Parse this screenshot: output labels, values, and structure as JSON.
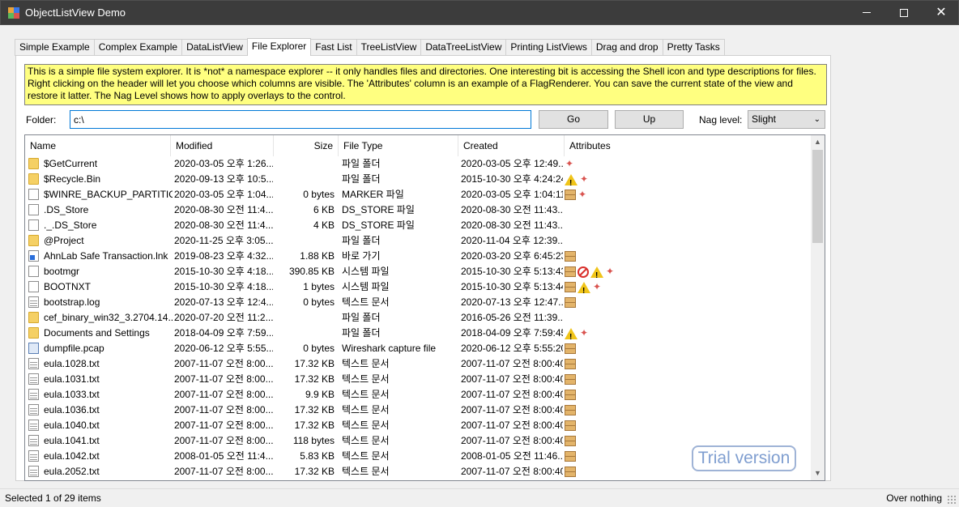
{
  "window": {
    "title": "ObjectListView Demo",
    "buttons": {
      "minimize": "—",
      "maximize": "□",
      "close": "✕"
    }
  },
  "tabs": [
    {
      "label": "Simple Example"
    },
    {
      "label": "Complex Example"
    },
    {
      "label": "DataListView"
    },
    {
      "label": "File Explorer",
      "active": true
    },
    {
      "label": "Fast List"
    },
    {
      "label": "TreeListView"
    },
    {
      "label": "DataTreeListView"
    },
    {
      "label": "Printing ListViews"
    },
    {
      "label": "Drag and drop"
    },
    {
      "label": "Pretty Tasks"
    }
  ],
  "info_text": "This is a simple file system explorer. It is *not* a namespace explorer -- it only handles files and directories. One interesting bit is accessing the Shell icon and type descriptions for files. Right clicking on the header will let you choose which columns are visible. The 'Attributes' column is an example of a FlagRenderer. You can save the current state of the view and restore it latter. The Nag Level shows how to apply overlays to the control.",
  "folder": {
    "label": "Folder:",
    "value": "c:\\"
  },
  "buttons": {
    "go": "Go",
    "up": "Up"
  },
  "nag": {
    "label": "Nag level:",
    "selected": "Slight"
  },
  "columns": [
    "Name",
    "Modified",
    "Size",
    "File Type",
    "Created",
    "Attributes"
  ],
  "rows": [
    {
      "icon": "folder",
      "name": "$GetCurrent",
      "modified": "2020-03-05 오후 1:26...",
      "size": "",
      "type": "파일 폴더",
      "created": "2020-03-05 오후 12:49...",
      "attrs": [
        "spark"
      ]
    },
    {
      "icon": "folder",
      "name": "$Recycle.Bin",
      "modified": "2020-09-13 오후 10:5...",
      "size": "",
      "type": "파일 폴더",
      "created": "2015-10-30 오후 4:24:24",
      "attrs": [
        "warn",
        "spark"
      ]
    },
    {
      "icon": "file",
      "name": "$WINRE_BACKUP_PARTITIO...",
      "modified": "2020-03-05 오후 1:04...",
      "size": "0 bytes",
      "type": "MARKER 파일",
      "created": "2020-03-05 오후 1:04:11",
      "attrs": [
        "pkg",
        "spark"
      ]
    },
    {
      "icon": "file",
      "name": ".DS_Store",
      "modified": "2020-08-30 오전 11:4...",
      "size": "6 KB",
      "type": "DS_STORE 파일",
      "created": "2020-08-30 오전 11:43...",
      "attrs": []
    },
    {
      "icon": "file",
      "name": "._.DS_Store",
      "modified": "2020-08-30 오전 11:4...",
      "size": "4 KB",
      "type": "DS_STORE 파일",
      "created": "2020-08-30 오전 11:43...",
      "attrs": []
    },
    {
      "icon": "folder",
      "name": "@Project",
      "modified": "2020-11-25 오후 3:05...",
      "size": "",
      "type": "파일 폴더",
      "created": "2020-11-04 오후 12:39...",
      "attrs": []
    },
    {
      "icon": "link",
      "name": "AhnLab Safe Transaction.lnk",
      "modified": "2019-08-23 오후 4:32...",
      "size": "1.88 KB",
      "type": "바로 가기",
      "created": "2020-03-20 오후 6:45:23",
      "attrs": [
        "pkg"
      ]
    },
    {
      "icon": "file",
      "name": "bootmgr",
      "modified": "2015-10-30 오후 4:18...",
      "size": "390.85 KB",
      "type": "시스템 파일",
      "created": "2015-10-30 오후 5:13:43",
      "attrs": [
        "pkg",
        "noentry",
        "warn",
        "spark"
      ]
    },
    {
      "icon": "file",
      "name": "BOOTNXT",
      "modified": "2015-10-30 오후 4:18...",
      "size": "1 bytes",
      "type": "시스템 파일",
      "created": "2015-10-30 오후 5:13:44",
      "attrs": [
        "pkg",
        "warn",
        "spark"
      ]
    },
    {
      "icon": "text",
      "name": "bootstrap.log",
      "modified": "2020-07-13 오후 12:4...",
      "size": "0 bytes",
      "type": "텍스트 문서",
      "created": "2020-07-13 오후 12:47...",
      "attrs": [
        "pkg"
      ]
    },
    {
      "icon": "folder",
      "name": "cef_binary_win32_3.2704.14...",
      "modified": "2020-07-20 오전 11:2...",
      "size": "",
      "type": "파일 폴더",
      "created": "2016-05-26 오전 11:39...",
      "attrs": []
    },
    {
      "icon": "folder",
      "name": "Documents and Settings",
      "modified": "2018-04-09 오후 7:59...",
      "size": "",
      "type": "파일 폴더",
      "created": "2018-04-09 오후 7:59:45",
      "attrs": [
        "warn",
        "spark"
      ]
    },
    {
      "icon": "pcap",
      "name": "dumpfile.pcap",
      "modified": "2020-06-12 오후 5:55...",
      "size": "0 bytes",
      "type": "Wireshark capture file",
      "created": "2020-06-12 오후 5:55:20",
      "attrs": [
        "pkg"
      ]
    },
    {
      "icon": "text",
      "name": "eula.1028.txt",
      "modified": "2007-11-07 오전 8:00...",
      "size": "17.32 KB",
      "type": "텍스트 문서",
      "created": "2007-11-07 오전 8:00:40",
      "attrs": [
        "pkg"
      ]
    },
    {
      "icon": "text",
      "name": "eula.1031.txt",
      "modified": "2007-11-07 오전 8:00...",
      "size": "17.32 KB",
      "type": "텍스트 문서",
      "created": "2007-11-07 오전 8:00:40",
      "attrs": [
        "pkg"
      ]
    },
    {
      "icon": "text",
      "name": "eula.1033.txt",
      "modified": "2007-11-07 오전 8:00...",
      "size": "9.9 KB",
      "type": "텍스트 문서",
      "created": "2007-11-07 오전 8:00:40",
      "attrs": [
        "pkg"
      ]
    },
    {
      "icon": "text",
      "name": "eula.1036.txt",
      "modified": "2007-11-07 오전 8:00...",
      "size": "17.32 KB",
      "type": "텍스트 문서",
      "created": "2007-11-07 오전 8:00:40",
      "attrs": [
        "pkg"
      ]
    },
    {
      "icon": "text",
      "name": "eula.1040.txt",
      "modified": "2007-11-07 오전 8:00...",
      "size": "17.32 KB",
      "type": "텍스트 문서",
      "created": "2007-11-07 오전 8:00:40",
      "attrs": [
        "pkg"
      ]
    },
    {
      "icon": "text",
      "name": "eula.1041.txt",
      "modified": "2007-11-07 오전 8:00...",
      "size": "118 bytes",
      "type": "텍스트 문서",
      "created": "2007-11-07 오전 8:00:40",
      "attrs": [
        "pkg"
      ]
    },
    {
      "icon": "text",
      "name": "eula.1042.txt",
      "modified": "2008-01-05 오전 11:4...",
      "size": "5.83 KB",
      "type": "텍스트 문서",
      "created": "2008-01-05 오전 11:46...",
      "attrs": [
        "pkg"
      ]
    },
    {
      "icon": "text",
      "name": "eula.2052.txt",
      "modified": "2007-11-07 오전 8:00...",
      "size": "17.32 KB",
      "type": "텍스트 문서",
      "created": "2007-11-07 오전 8:00:40",
      "attrs": [
        "pkg"
      ]
    }
  ],
  "overlay": {
    "trial": "Trial version"
  },
  "status": {
    "left": "Selected 1 of 29 items",
    "right": "Over nothing"
  }
}
